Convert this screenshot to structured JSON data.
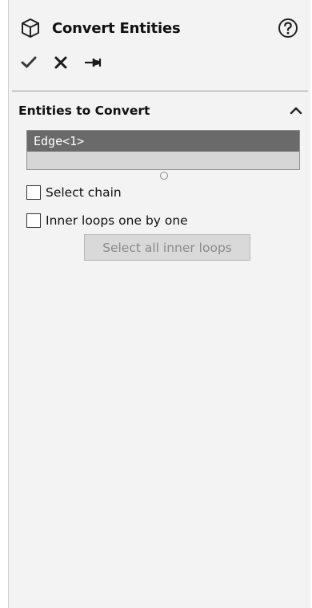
{
  "header": {
    "title": "Convert Entities",
    "icon": "cube-icon",
    "help_icon": "help-icon"
  },
  "toolbar": {
    "ok_icon": "checkmark-icon",
    "cancel_icon": "close-icon",
    "pin_icon": "pushpin-icon"
  },
  "group": {
    "title": "Entities to Convert",
    "collapse_icon": "chevron-up-icon",
    "items": [
      "Edge<1>"
    ],
    "options": [
      {
        "label": "Select chain",
        "checked": false
      },
      {
        "label": "Inner loops one by one",
        "checked": false
      }
    ],
    "button_label": "Select all inner loops"
  },
  "colors": {
    "panel_bg": "#f3f3f3",
    "selected_item_bg": "#6a6a6a",
    "listbox_bg": "#d6d6d6",
    "disabled_button_bg": "#d9d9d9"
  }
}
